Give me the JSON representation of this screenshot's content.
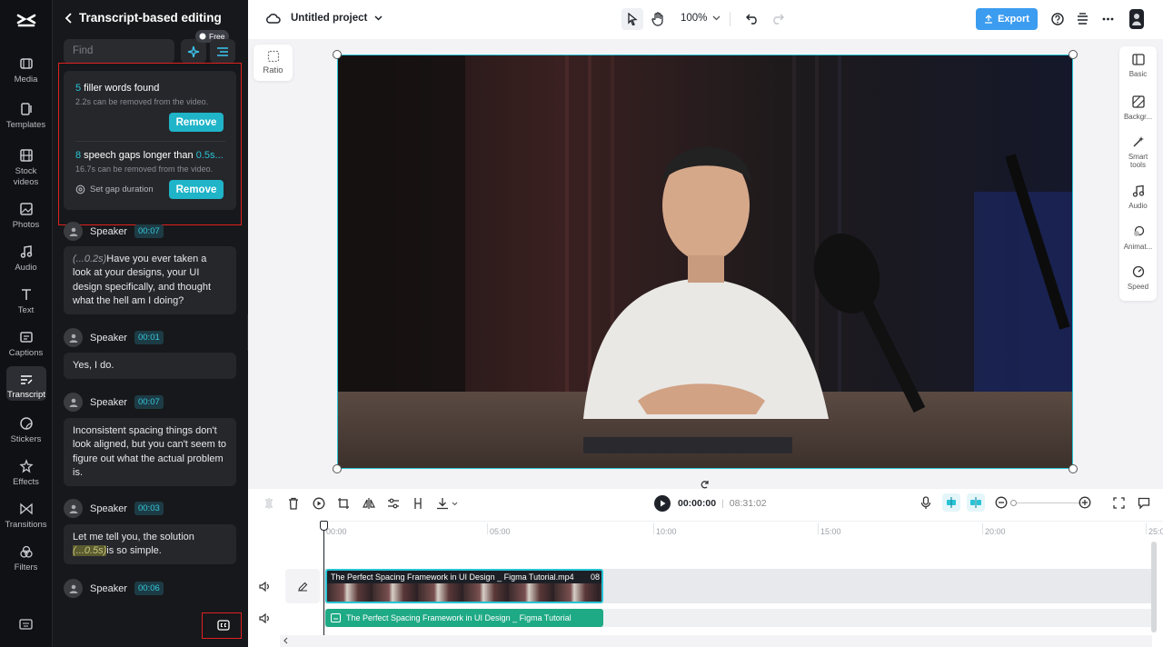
{
  "rail": {
    "items": [
      {
        "key": "media",
        "label": "Media"
      },
      {
        "key": "templates",
        "label": "Templates"
      },
      {
        "key": "stock",
        "label": "Stock videos"
      },
      {
        "key": "photos",
        "label": "Photos"
      },
      {
        "key": "audio",
        "label": "Audio"
      },
      {
        "key": "text",
        "label": "Text"
      },
      {
        "key": "captions",
        "label": "Captions"
      },
      {
        "key": "transcript",
        "label": "Transcript"
      },
      {
        "key": "stickers",
        "label": "Stickers"
      },
      {
        "key": "effects",
        "label": "Effects"
      },
      {
        "key": "transitions",
        "label": "Transitions"
      },
      {
        "key": "filters",
        "label": "Filters"
      }
    ]
  },
  "panel": {
    "title": "Transcript-based editing",
    "find_placeholder": "Find",
    "free_badge": "Free",
    "filler": {
      "count": "5",
      "title_rest": " filler words found",
      "sub": "2.2s can be removed from the video.",
      "button": "Remove"
    },
    "gaps": {
      "count": "8",
      "title_mid": " speech gaps longer than ",
      "threshold": "0.5s...",
      "sub": "16.7s can be removed from the video.",
      "setting": "Set gap duration",
      "button": "Remove"
    },
    "segments": [
      {
        "speaker": "Speaker",
        "time": "00:07",
        "gap": "(...0.2s)",
        "text": "Have you ever taken a look at your designs, your UI design specifically, and thought what the hell am I doing?"
      },
      {
        "speaker": "Speaker",
        "time": "00:01",
        "text": "Yes, I do."
      },
      {
        "speaker": "Speaker",
        "time": "00:07",
        "text": "Inconsistent spacing things don't look aligned, but you can't seem to figure out what the actual problem is."
      },
      {
        "speaker": "Speaker",
        "time": "00:03",
        "text_before": "Let me tell you, the solution ",
        "gap": "(...0.5s)",
        "text_after": "is so simple."
      },
      {
        "speaker": "Speaker",
        "time": "00:06"
      }
    ]
  },
  "topbar": {
    "project": "Untitled project",
    "zoom": "100%",
    "export": "Export"
  },
  "canvas": {
    "ratio": "Ratio"
  },
  "right_tools": [
    {
      "key": "basic",
      "label": "Basic"
    },
    {
      "key": "background",
      "label": "Backgr..."
    },
    {
      "key": "smart",
      "label": "Smart tools"
    },
    {
      "key": "audio",
      "label": "Audio"
    },
    {
      "key": "animation",
      "label": "Animat..."
    },
    {
      "key": "speed",
      "label": "Speed"
    }
  ],
  "timeline": {
    "current": "00:00:00",
    "separator": "|",
    "total": "08:31:02",
    "ticks": [
      "00:00",
      "05:00",
      "10:00",
      "15:00",
      "20:00",
      "25:0"
    ],
    "video_clip": "The Perfect Spacing Framework in UI Design _ Figma Tutorial.mp4",
    "video_clip_duration": "08",
    "caption_clip": "The Perfect Spacing Framework in UI Design _ Figma Tutorial"
  },
  "colors": {
    "accent": "#1fb4c8",
    "export_bg": "#3b9cf0",
    "highlight_box": "#e02020",
    "caption_track": "#1faa86"
  }
}
